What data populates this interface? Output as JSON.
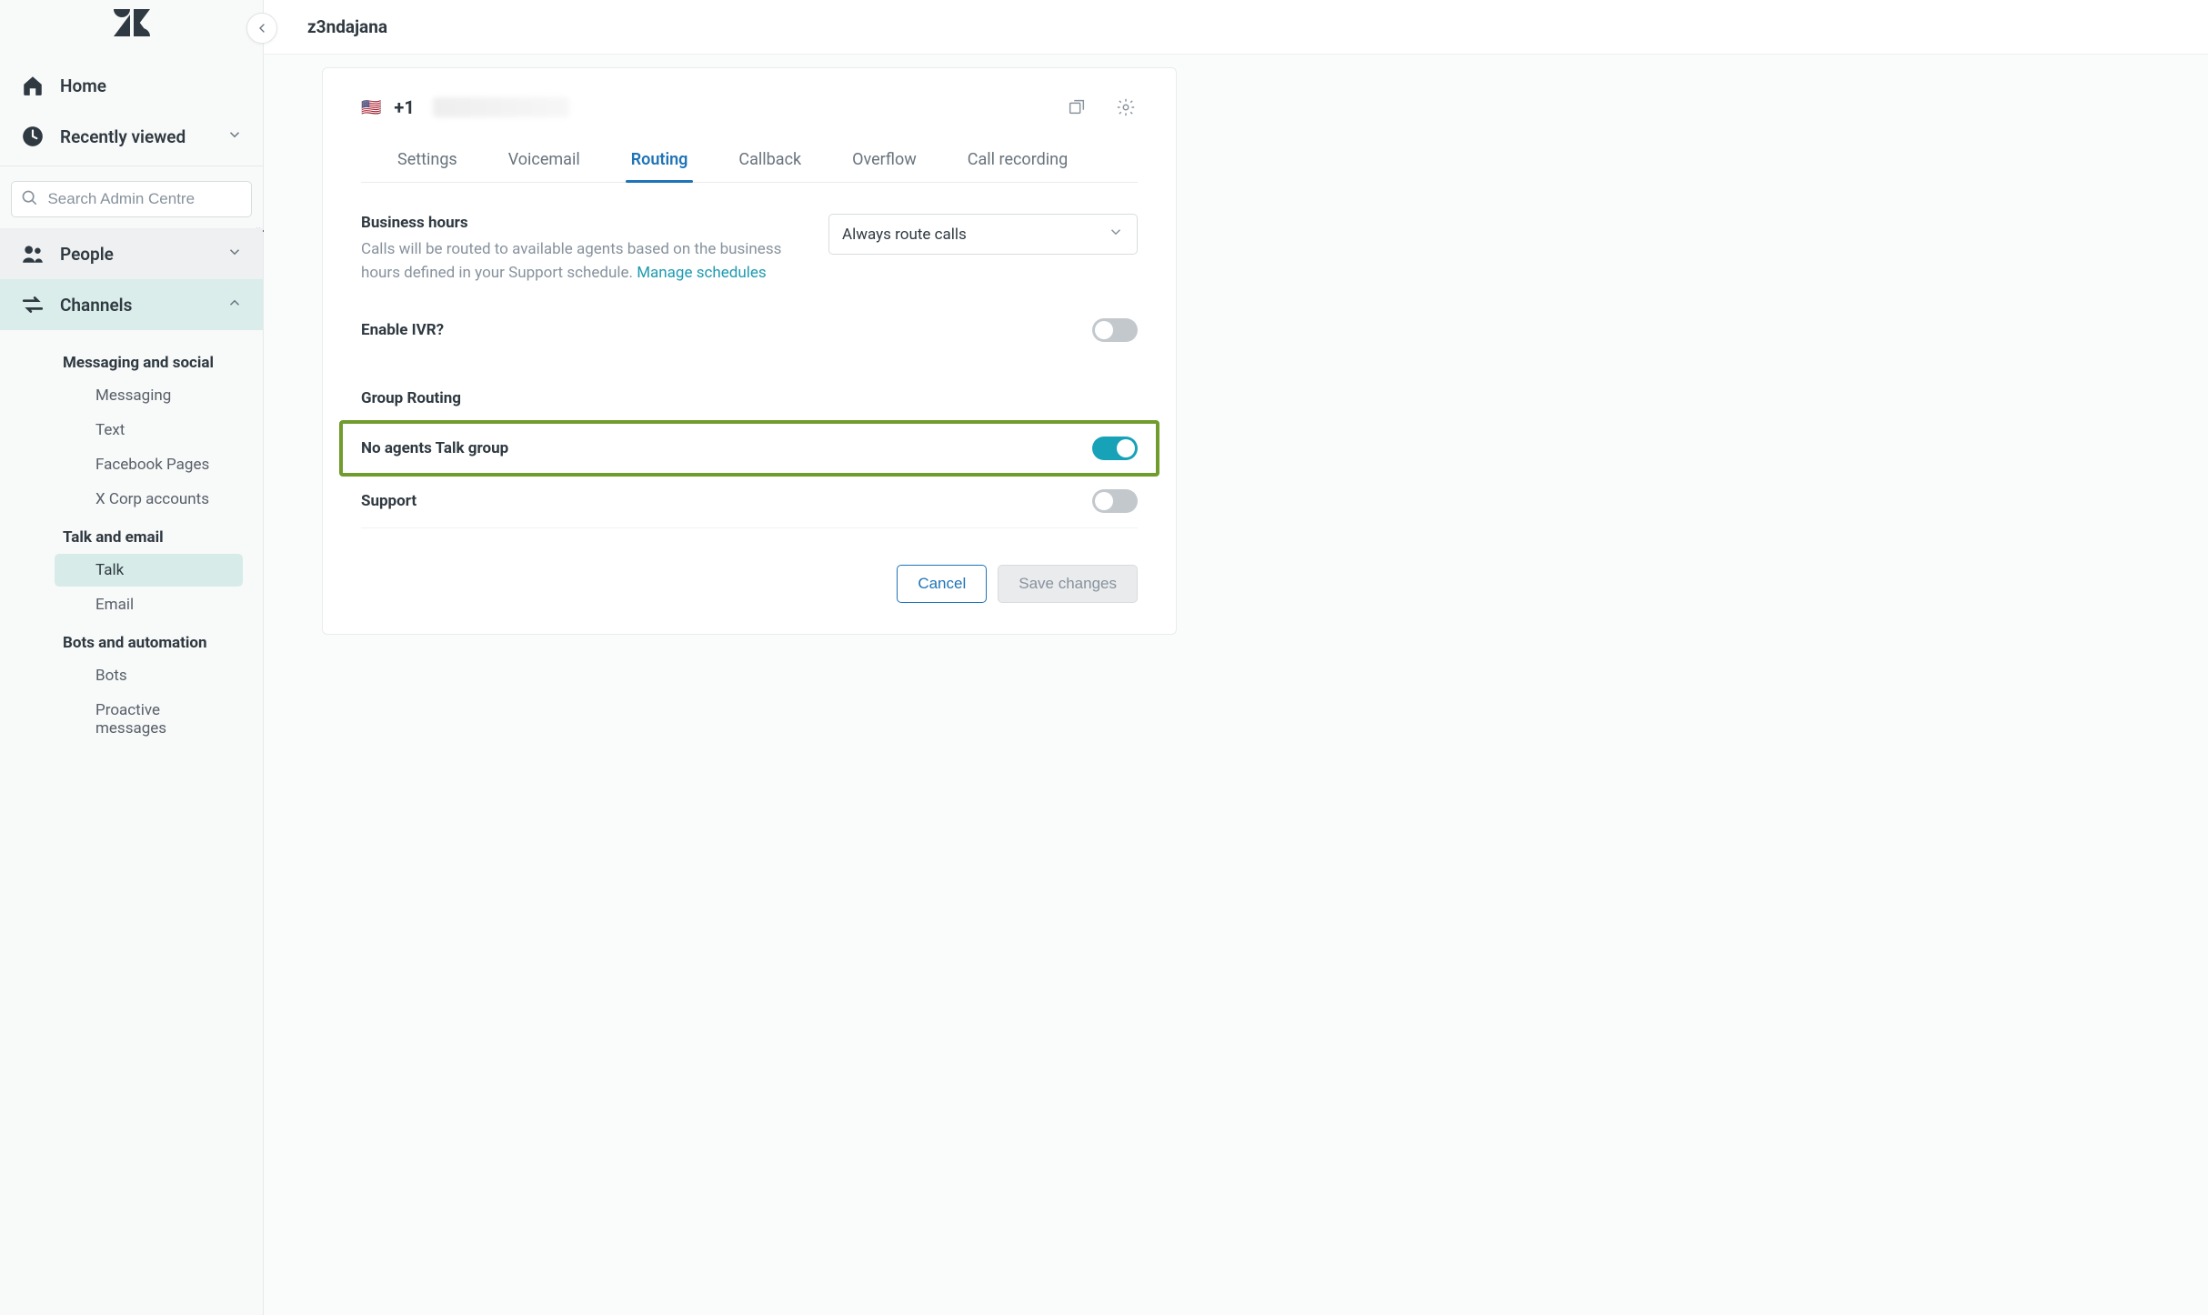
{
  "breadcrumb": "z3ndajana",
  "sidebar": {
    "logo_alt": "Zendesk",
    "home_label": "Home",
    "recently_viewed_label": "Recently viewed",
    "search_placeholder": "Search Admin Centre",
    "people_label": "People",
    "channels_label": "Channels",
    "groups": [
      {
        "header": "Messaging and social",
        "items": [
          "Messaging",
          "Text",
          "Facebook Pages",
          "X Corp accounts"
        ]
      },
      {
        "header": "Talk and email",
        "items": [
          "Talk",
          "Email"
        ],
        "active_index": 0
      },
      {
        "header": "Bots and automation",
        "items": [
          "Bots",
          "Proactive messages"
        ]
      }
    ]
  },
  "card": {
    "phone_prefix": "+1",
    "tabs": [
      "Settings",
      "Voicemail",
      "Routing",
      "Callback",
      "Overflow",
      "Call recording"
    ],
    "active_tab_index": 2,
    "business_hours": {
      "title": "Business hours",
      "desc_prefix": "Calls will be routed to available agents based on the business hours defined in your Support schedule. ",
      "link_text": "Manage schedules",
      "select_value": "Always route calls"
    },
    "enable_ivr_label": "Enable IVR?",
    "enable_ivr_on": false,
    "group_routing_label": "Group Routing",
    "groups": [
      {
        "label": "No agents Talk group",
        "on": true,
        "highlight": true
      },
      {
        "label": "Support",
        "on": false,
        "highlight": false
      }
    ],
    "cancel_label": "Cancel",
    "save_label": "Save changes"
  }
}
